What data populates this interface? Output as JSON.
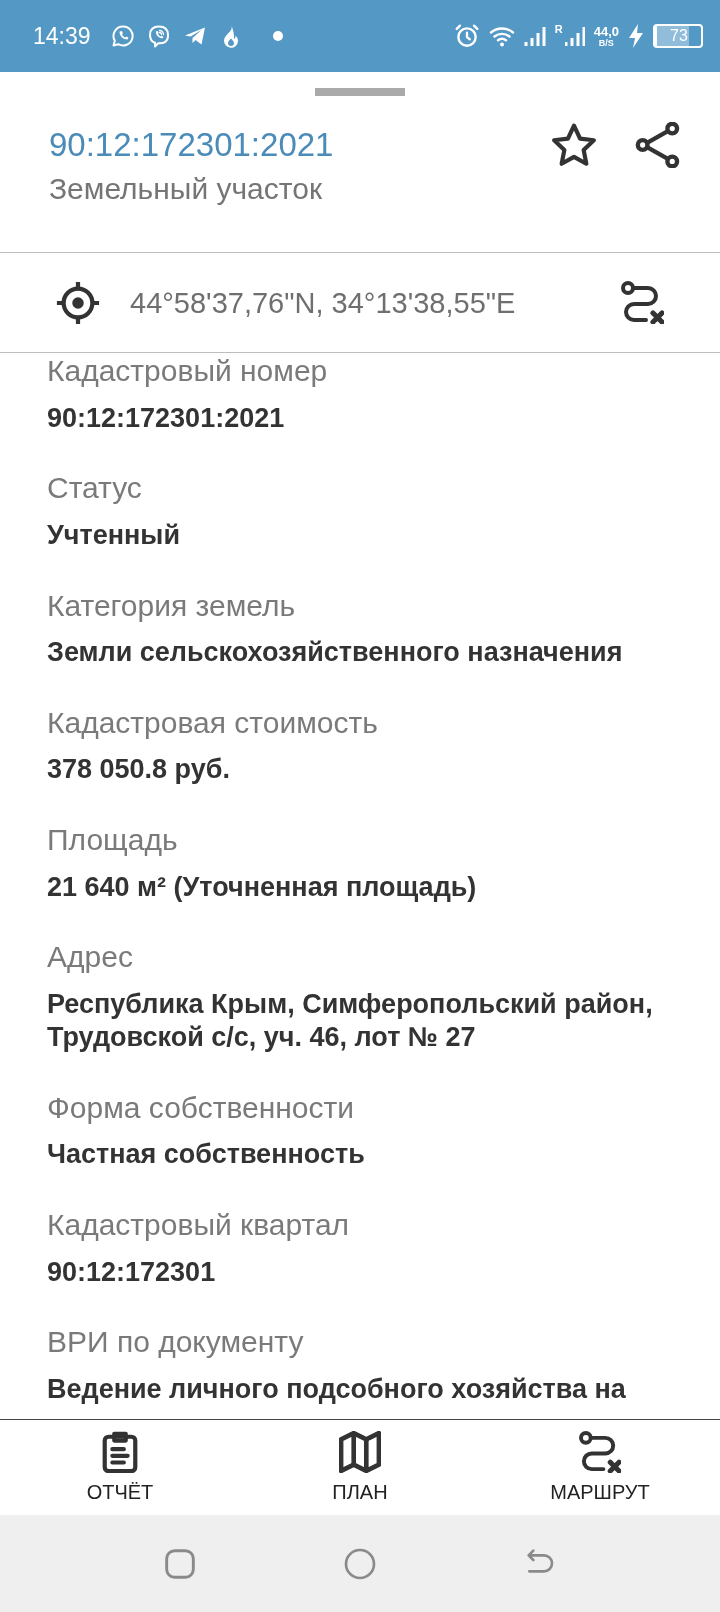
{
  "status_bar": {
    "time": "14:39",
    "roaming": "R",
    "speed": "44,0",
    "speed_unit": "B/S",
    "battery": "73"
  },
  "sheet": {
    "title": "90:12:172301:2021",
    "subtitle": "Земельный участок",
    "coordinates": "44°58'37,76\"N, 34°13'38,55\"E"
  },
  "fields": [
    {
      "label": "Кадастровый номер",
      "value": "90:12:172301:2021"
    },
    {
      "label": "Статус",
      "value": "Учтенный"
    },
    {
      "label": "Категория земель",
      "value": "Земли сельскохозяйственного назначения"
    },
    {
      "label": "Кадастровая стоимость",
      "value": "378 050.8 руб."
    },
    {
      "label": "Площадь",
      "value": "21 640 м² (Уточненная площадь)"
    },
    {
      "label": "Адрес",
      "value": "Республика Крым, Симферопольский район, Трудовской с/с, уч. 46, лот № 27"
    },
    {
      "label": "Форма собственности",
      "value": "Частная собственность"
    },
    {
      "label": "Кадастровый квартал",
      "value": "90:12:172301"
    },
    {
      "label": "ВРИ по документу",
      "value": "Ведение личного подсобного хозяйства на"
    }
  ],
  "bottom_nav": [
    {
      "label": "ОТЧЁТ"
    },
    {
      "label": "ПЛАН"
    },
    {
      "label": "МАРШРУТ"
    }
  ]
}
